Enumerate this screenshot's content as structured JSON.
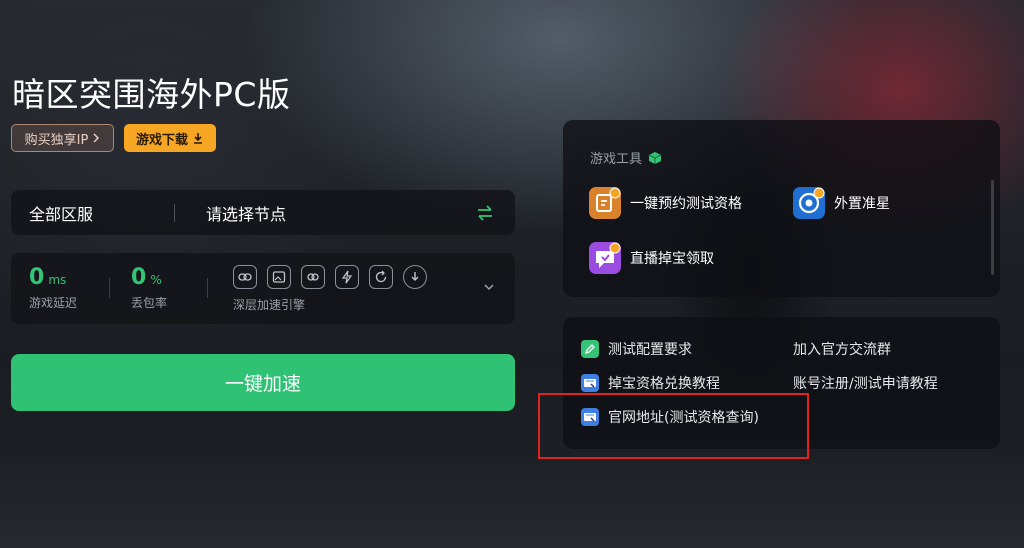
{
  "game": {
    "title": "暗区突围海外PC版",
    "buy_ip_label": "购买独享IP",
    "download_label": "游戏下载"
  },
  "region": {
    "all_label": "全部区服",
    "node_placeholder": "请选择节点"
  },
  "stats": {
    "latency_value": "0",
    "latency_unit": "ms",
    "latency_label": "游戏延迟",
    "loss_value": "0",
    "loss_unit": "%",
    "loss_label": "丢包率",
    "engine_label": "深层加速引擎",
    "engine_icons": [
      "link-icon",
      "image-icon",
      "connect-icon",
      "flash-icon",
      "refresh-icon",
      "download-icon"
    ]
  },
  "accelerate_label": "一键加速",
  "tools": {
    "title": "游戏工具",
    "items": [
      {
        "label": "一键预约测试资格",
        "icon": "reservation-icon"
      },
      {
        "label": "外置准星",
        "icon": "crosshair-icon"
      },
      {
        "label": "直播掉宝领取",
        "icon": "live-drop-icon"
      }
    ]
  },
  "links": {
    "items": [
      {
        "label": "测试配置要求",
        "icon": "pencil-icon"
      },
      {
        "label": "加入官方交流群",
        "icon": ""
      },
      {
        "label": "掉宝资格兑换教程",
        "icon": "web-icon"
      },
      {
        "label": "账号注册/测试申请教程",
        "icon": ""
      },
      {
        "label": "官网地址(测试资格查询)",
        "icon": "web-icon"
      }
    ]
  },
  "colors": {
    "accent_green": "#2fc274",
    "download_orange": "#f6a623",
    "highlight_red": "#e0241c"
  }
}
